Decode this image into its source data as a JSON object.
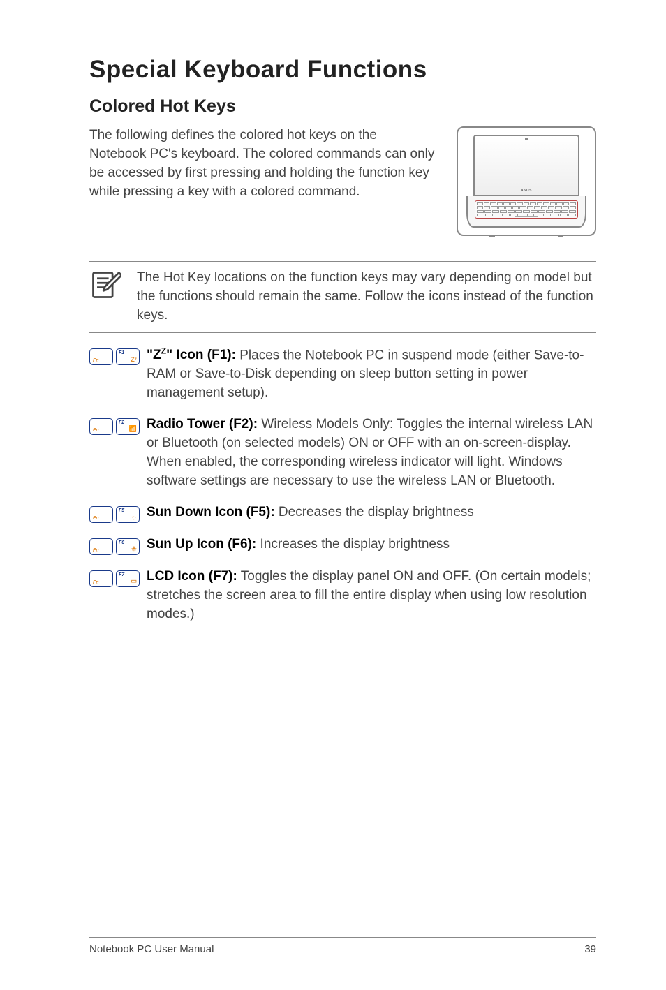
{
  "title": "Special Keyboard Functions",
  "subtitle": "Colored Hot Keys",
  "intro": "The following defines the colored hot keys on the Notebook PC's keyboard. The colored commands can only be accessed by first pressing and holding the function key while pressing a key with a colored command.",
  "laptop_logo": "ASUS",
  "note": "The Hot Key locations on the function keys may vary depending on model but the functions should remain the same. Follow the icons instead of the function keys.",
  "items": [
    {
      "fkey": "F1",
      "glyph": "Zᶻ",
      "bold_html": "\"Z<sup>Z</sup>\" Icon (F1):",
      "desc": " Places the Notebook PC in suspend mode (either Save-to-RAM or Save-to-Disk depending on sleep button setting in power management setup)."
    },
    {
      "fkey": "F2",
      "glyph": "📶",
      "bold_html": "Radio Tower (F2):",
      "desc": " Wireless Models Only: Toggles the internal wireless LAN or Bluetooth (on selected models) ON or OFF with an on-screen-display. When enabled, the corresponding wireless indicator will light. Windows software settings are necessary to use the wireless LAN or Bluetooth."
    },
    {
      "fkey": "F5",
      "glyph": "☼",
      "bold_html": "Sun Down Icon (F5):",
      "desc": " Decreases the display brightness"
    },
    {
      "fkey": "F6",
      "glyph": "☀",
      "bold_html": "Sun Up Icon (F6):",
      "desc": " Increases the display brightness"
    },
    {
      "fkey": "F7",
      "glyph": "▭",
      "bold_html": "LCD Icon (F7):",
      "desc": " Toggles the display panel ON and OFF. (On certain models; stretches the screen area to fill the entire display when using low resolution modes.)"
    }
  ],
  "fn_key_label": "Fn",
  "footer_left": "Notebook PC User Manual",
  "footer_right": "39"
}
